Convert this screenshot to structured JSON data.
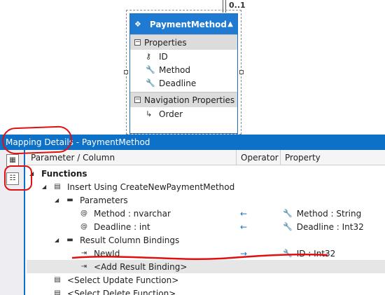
{
  "designer": {
    "multiplicity": "0..1",
    "entity": {
      "title": "PaymentMethod",
      "collapse_icon": "chevron-up-icon",
      "sections": [
        {
          "title": "Properties",
          "items": [
            {
              "icon": "key-icon",
              "label": "ID"
            },
            {
              "icon": "wrench-icon",
              "label": "Method"
            },
            {
              "icon": "wrench-icon",
              "label": "Deadline"
            }
          ]
        },
        {
          "title": "Navigation Properties",
          "items": [
            {
              "icon": "navigation-icon",
              "label": "Order"
            }
          ]
        }
      ]
    }
  },
  "panel": {
    "title": "Mapping Details - PaymentMethod",
    "columns": [
      "Parameter / Column",
      "Operator",
      "Property"
    ],
    "rows": {
      "functions": "Functions",
      "insert": "Insert Using CreateNewPaymentMethod",
      "parameters": "Parameters",
      "p1_name": "Method : nvarchar",
      "p1_op": "←",
      "p1_prop": "Method : String",
      "p2_name": "Deadline : int",
      "p2_op": "←",
      "p2_prop": "Deadline : Int32",
      "result_bindings": "Result Column Bindings",
      "r1_name": "NewId",
      "r1_op": "→",
      "r1_prop": "ID : Int32",
      "add_binding": "<Add Result Binding>",
      "update": "<Select Update Function>",
      "delete": "<Select Delete Function>"
    }
  },
  "colors": {
    "accent": "#0e71c8",
    "annotation": "#e01010"
  }
}
